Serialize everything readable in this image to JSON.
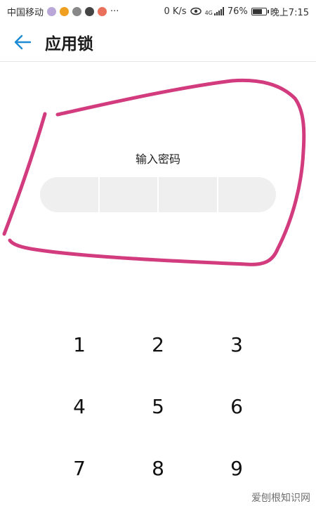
{
  "status_bar": {
    "carrier": "中国移动",
    "more": "···",
    "net_speed": "0 K/s",
    "net_type": "4G",
    "battery": "76%",
    "battery_level": 0.76,
    "time": "晚上7:15"
  },
  "header": {
    "title": "应用锁",
    "back_icon": "arrow-left-icon",
    "accent": "#1c8ad4"
  },
  "pin": {
    "label": "输入密码",
    "digits": 4,
    "entered": 0
  },
  "keypad": {
    "keys": [
      "1",
      "2",
      "3",
      "4",
      "5",
      "6",
      "7",
      "8",
      "9"
    ]
  },
  "annotation": {
    "color": "#d23c7e"
  },
  "watermark": {
    "text": "爱刨根知识网"
  }
}
